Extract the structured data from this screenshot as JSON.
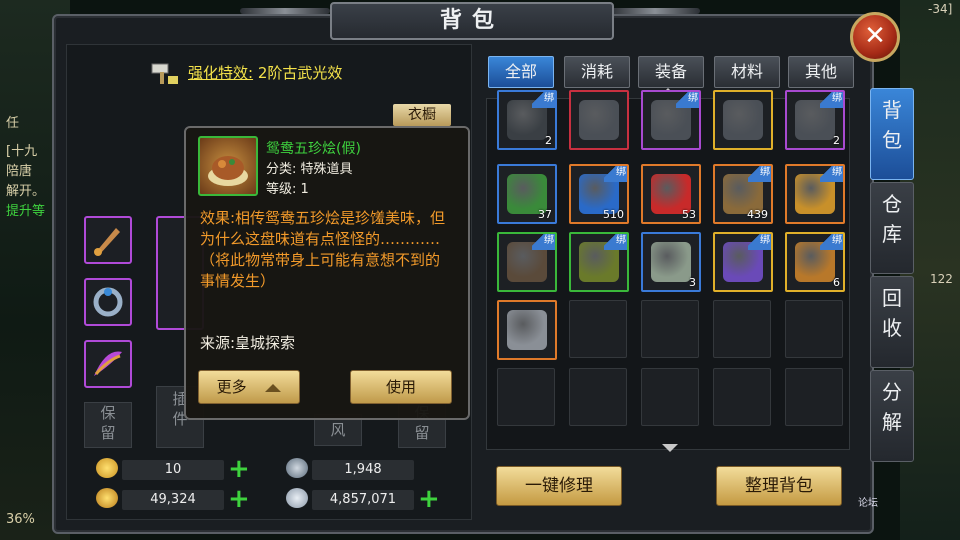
{
  "window": {
    "title": "背包",
    "close_glyph": "✕"
  },
  "background": {
    "left_texts": [
      "任",
      "[十九",
      "陪唐",
      "解开。",
      "提升等"
    ],
    "left_percent": "36%",
    "right_numbers": [
      "-34]",
      "122"
    ]
  },
  "left_panel": {
    "enhance_label": "强化特效:",
    "enhance_value": "2阶古武光效",
    "wardrobe_button": "衣橱",
    "empty_slots": [
      "保\n留",
      "插\n件",
      "风",
      "保\n留"
    ]
  },
  "tooltip": {
    "item_name": "鸳鸯五珍烩(假)",
    "category": "分类: 特殊道具",
    "level": "等级: 1",
    "description": "效果:相传鸳鸯五珍烩是珍馐美味，但为什么这盘味道有点怪怪的…………（将此物常带身上可能有意想不到的事情发生）",
    "source": "来源:皇城探索",
    "more_button": "更多",
    "use_button": "使用"
  },
  "currency": {
    "gold_ingot": "10",
    "gold_coin": "49,324",
    "token": "1,948",
    "silver": "4,857,071",
    "plus_glyph": "+"
  },
  "tabs": [
    "全部",
    "消耗",
    "装备",
    "材料",
    "其他"
  ],
  "side_tabs": [
    "背\n包",
    "仓\n库",
    "回\n收",
    "分\n解"
  ],
  "grid_items": [
    {
      "border": "blue",
      "count": "2",
      "bind": "绑",
      "art": "#3a3f44"
    },
    {
      "border": "red",
      "count": "",
      "bind": "",
      "art": "#4a4f56"
    },
    {
      "border": "purple",
      "count": "",
      "bind": "绑",
      "art": "#4a4f56"
    },
    {
      "border": "gold",
      "count": "",
      "bind": "",
      "art": "#4a4f56"
    },
    {
      "border": "purple",
      "count": "2",
      "bind": "绑",
      "art": "#4a4f56"
    },
    {
      "border": "blue",
      "count": "37",
      "bind": "",
      "art": "#3a8a3a"
    },
    {
      "border": "orange",
      "count": "510",
      "bind": "绑",
      "art": "#2a6ac8"
    },
    {
      "border": "orange",
      "count": "53",
      "bind": "",
      "art": "#c82a2a"
    },
    {
      "border": "orange",
      "count": "439",
      "bind": "绑",
      "art": "#8a6a3a"
    },
    {
      "border": "orange",
      "count": "",
      "bind": "绑",
      "art": "#c8902a"
    },
    {
      "border": "green",
      "count": "",
      "bind": "绑",
      "art": "#5a4a3a"
    },
    {
      "border": "green",
      "count": "",
      "bind": "绑",
      "art": "#6a7a2a"
    },
    {
      "border": "blue",
      "count": "3",
      "bind": "",
      "art": "#8a9a8a"
    },
    {
      "border": "gold",
      "count": "",
      "bind": "绑",
      "art": "#6a4ab8"
    },
    {
      "border": "gold",
      "count": "6",
      "bind": "绑",
      "art": "#b8782a"
    },
    {
      "border": "orange",
      "count": "",
      "bind": "",
      "art": "#8a8f96"
    },
    {
      "border": "none",
      "count": "",
      "bind": "",
      "art": ""
    },
    {
      "border": "none",
      "count": "",
      "bind": "",
      "art": ""
    },
    {
      "border": "none",
      "count": "",
      "bind": "",
      "art": ""
    },
    {
      "border": "none",
      "count": "",
      "bind": "",
      "art": ""
    },
    {
      "border": "none",
      "count": "",
      "bind": "",
      "art": ""
    },
    {
      "border": "none",
      "count": "",
      "bind": "",
      "art": ""
    },
    {
      "border": "none",
      "count": "",
      "bind": "",
      "art": ""
    },
    {
      "border": "none",
      "count": "",
      "bind": "",
      "art": ""
    },
    {
      "border": "none",
      "count": "",
      "bind": "",
      "art": ""
    }
  ],
  "buttons": {
    "repair_all": "一键修理",
    "sort_bag": "整理背包"
  },
  "watermark": "论坛",
  "icons": [
    "hammer-icon",
    "close-icon",
    "arrow-up-icon",
    "arrow-down-icon",
    "gold-ingot-icon",
    "gold-coin-icon",
    "token-icon",
    "silver-icon",
    "plus-icon"
  ]
}
